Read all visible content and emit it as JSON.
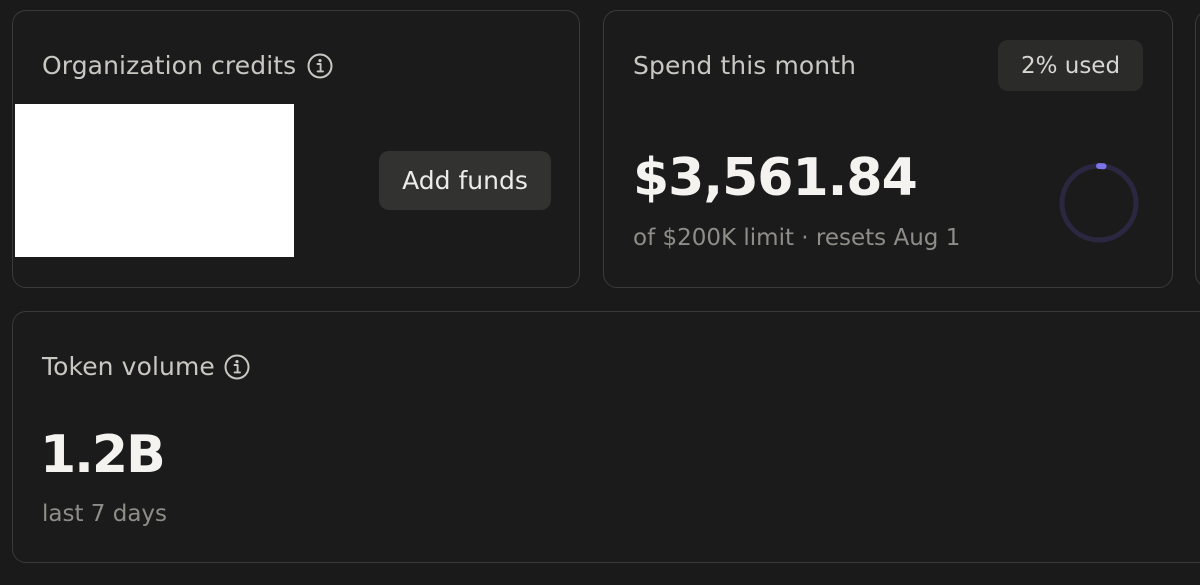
{
  "credits_card": {
    "title": "Organization credits",
    "info_icon": "info-icon",
    "add_funds_label": "Add funds"
  },
  "spend_card": {
    "title": "Spend this month",
    "badge": "2% used",
    "amount": "$3,561.84",
    "subtext": "of $200K limit · resets Aug 1",
    "usage_fraction": 0.02,
    "ring_track_color": "#2b2740",
    "ring_fill_color": "#7b74e6"
  },
  "tokens_card": {
    "title": "Token volume",
    "info_icon": "info-icon",
    "value": "1.2B",
    "subtext": "last 7 days"
  }
}
